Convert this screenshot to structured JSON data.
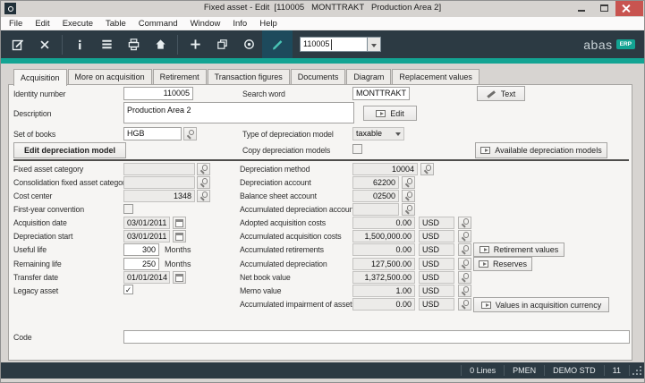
{
  "colors": {
    "accent_teal": "#13a493",
    "toolbar_bg": "#2c3a43",
    "active_tool_bg": "#1d4a5c",
    "close_red": "#c85450"
  },
  "win": {
    "title": "Fixed asset - Edit  [110005   MONTTRAKT   Production Area 2]"
  },
  "menu": {
    "items": [
      "File",
      "Edit",
      "Execute",
      "Table",
      "Command",
      "Window",
      "Info",
      "Help"
    ]
  },
  "toolbar": {
    "record_id": "110005",
    "brand": "abas",
    "badge": "ERP"
  },
  "icons": [
    "app-icon",
    "minimize-icon",
    "maximize-icon",
    "close-window-icon",
    "save-record-icon",
    "cancel-icon",
    "info-icon",
    "list-icon",
    "print-icon",
    "home-icon",
    "new-record-icon",
    "copy-record-icon",
    "view-record-icon",
    "edit-record-pencil-icon",
    "dropdown-arrow-icon",
    "lookup-magnifier-icon",
    "calendar-icon",
    "open-dialog-icon",
    "text-pencil-icon",
    "resize-grip-icon"
  ],
  "tabs": {
    "active": "Acquisition",
    "items": [
      "Acquisition",
      "More on acquisition",
      "Retirement",
      "Transaction figures",
      "Documents",
      "Diagram",
      "Replacement values"
    ]
  },
  "form": {
    "identity_number_label": "Identity number",
    "identity_number": "110005",
    "search_word_label": "Search word",
    "search_word": "MONTTRAKT",
    "text_button": "Text",
    "description_label": "Description",
    "description": "Production Area 2",
    "edit_button": "Edit",
    "set_of_books_label": "Set of books",
    "set_of_books": "HGB",
    "type_of_depreciation_model_label": "Type of depreciation model",
    "type_of_depreciation_model": "taxable",
    "edit_depreciation_model_button": "Edit depreciation model",
    "copy_depreciation_models_label": "Copy depreciation models",
    "copy_depreciation_models_checked": "",
    "available_depreciation_models_button": "Available depreciation models"
  },
  "asset": {
    "fixed_asset_category_label": "Fixed asset category",
    "fixed_asset_category": "",
    "consolidation_category_label": "Consolidation fixed asset category",
    "consolidation_category": "",
    "cost_center_label": "Cost center",
    "cost_center": "1348",
    "first_year_convention_label": "First-year convention",
    "first_year_convention_checked": "",
    "acquisition_date_label": "Acquisition date",
    "acquisition_date": "03/01/2011",
    "depreciation_start_label": "Depreciation start",
    "depreciation_start": "03/01/2011",
    "useful_life_label": "Useful life",
    "useful_life": "300",
    "useful_life_unit": "Months",
    "remaining_life_label": "Remaining life",
    "remaining_life": "250",
    "remaining_life_unit": "Months",
    "transfer_date_label": "Transfer date",
    "transfer_date": "01/01/2014",
    "legacy_asset_label": "Legacy asset",
    "legacy_asset_checked": "✓"
  },
  "valuation": {
    "currency": "USD",
    "depreciation_method_label": "Depreciation method",
    "depreciation_method": "10004",
    "depreciation_account_label": "Depreciation account",
    "depreciation_account": "62200",
    "balance_sheet_account_label": "Balance sheet account",
    "balance_sheet_account": "02500",
    "accumulated_depreciation_account_label": "Accumulated depreciation account",
    "accumulated_depreciation_account": "",
    "adopted_acquisition_costs_label": "Adopted acquisition costs",
    "adopted_acquisition_costs": "0.00",
    "accumulated_acquisition_costs_label": "Accumulated acquisition costs",
    "accumulated_acquisition_costs": "1,500,000.00",
    "accumulated_retirements_label": "Accumulated retirements",
    "accumulated_retirements": "0.00",
    "retirement_values_button": "Retirement values",
    "accumulated_depreciation_label": "Accumulated depreciation",
    "accumulated_depreciation": "127,500.00",
    "reserves_button": "Reserves",
    "net_book_value_label": "Net book value",
    "net_book_value": "1,372,500.00",
    "memo_value_label": "Memo value",
    "memo_value": "1.00",
    "accumulated_impairment_label": "Accumulated impairment of assets",
    "accumulated_impairment": "0.00",
    "values_in_acquisition_currency_button": "Values in acquisition currency"
  },
  "code": {
    "label": "Code",
    "value": ""
  },
  "status": {
    "segments": [
      "0 Lines",
      "PMEN",
      "DEMO STD",
      "11"
    ]
  }
}
